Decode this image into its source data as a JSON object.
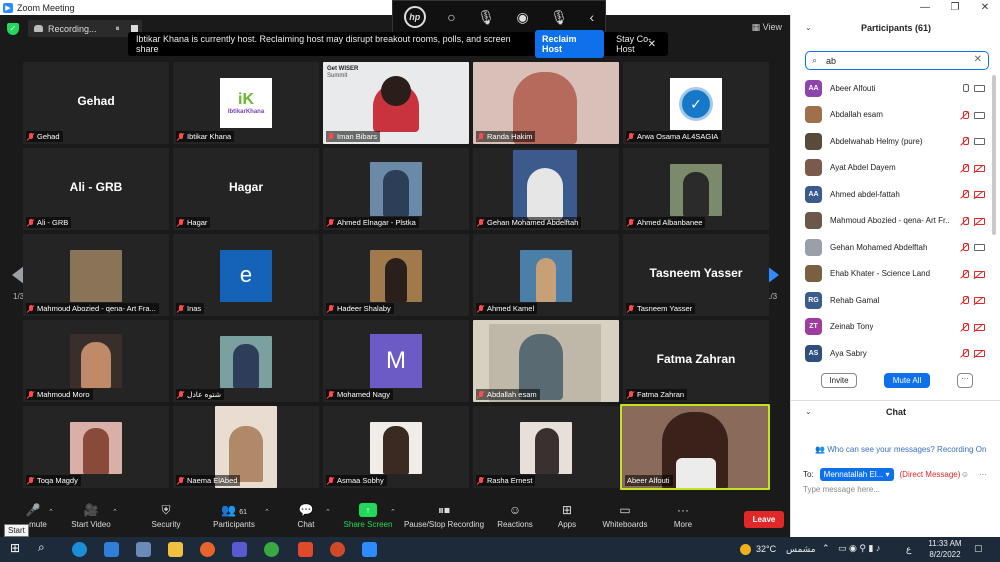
{
  "window": {
    "title": "Zoom Meeting",
    "minimize": "—",
    "restore": "❐",
    "close": "✕"
  },
  "topbar": {
    "recording": "Recording...",
    "pause": "⏸",
    "view": "View"
  },
  "hostbar": {
    "message": "Ibtikar Khana is currently host. Reclaiming host may disrupt breakout rooms, polls, and screen share",
    "reclaim": "Reclaim Host",
    "stay": "Stay Co-Host",
    "close": "✕"
  },
  "pager": {
    "left": "1/3",
    "right": "1/3"
  },
  "tiles": [
    {
      "label": "Gehad",
      "bigname": "Gehad"
    },
    {
      "label": "Ibtikar Khana",
      "logo_text": "iK",
      "logo_sub": "IbtikarKhana"
    },
    {
      "label": "Iman Bibars",
      "banner_title": "Get WISER",
      "banner_sub": "Summit"
    },
    {
      "label": "Randa Hakim"
    },
    {
      "label": "Arwa Osama AL4SAGIA"
    },
    {
      "label": "Ali - GRB",
      "bigname": "Ali - GRB"
    },
    {
      "label": "Hagar",
      "bigname": "Hagar"
    },
    {
      "label": "Ahmed Elnagar - Plstka"
    },
    {
      "label": "Gehan Mohamed Abdelftah"
    },
    {
      "label": "Ahmed Albanbanee"
    },
    {
      "label": "Mahmoud Abozied - qena- Art Fra..."
    },
    {
      "label": "Inas",
      "letter": "e"
    },
    {
      "label": "Hadeer Shalaby"
    },
    {
      "label": "Ahmed Kamel"
    },
    {
      "label": "Tasneem Yasser",
      "bigname": "Tasneem Yasser"
    },
    {
      "label": "Mahmoud Moro"
    },
    {
      "label": "شتوه عادل"
    },
    {
      "label": "Mohamed Nagy",
      "letter": "M"
    },
    {
      "label": "Abdallah esam"
    },
    {
      "label": "Fatma Zahran",
      "bigname": "Fatma Zahran"
    },
    {
      "label": "Toqa Magdy"
    },
    {
      "label": "Naema ElAbed"
    },
    {
      "label": "Asmaa Sobhy"
    },
    {
      "label": "Rasha Ernest"
    },
    {
      "label": "Abeer Alfouti"
    }
  ],
  "toolbar": {
    "mute": "mute",
    "start_tip": "Start",
    "start_video": "Start Video",
    "security": "Security",
    "participants": "Participants",
    "participants_count": "61",
    "chat": "Chat",
    "share": "Share Screen",
    "pause_rec": "Pause/Stop Recording",
    "reactions": "Reactions",
    "apps": "Apps",
    "whiteboards": "Whiteboards",
    "more": "More",
    "leave": "Leave"
  },
  "participants": {
    "header": "Participants (61)",
    "search_value": "ab",
    "list": [
      {
        "name": "Abeer Alfouti",
        "initials": "AA",
        "color": "#8e44ad",
        "mic": "on",
        "cam": "on"
      },
      {
        "name": "Abdallah esam",
        "initials": "",
        "color": "#a0704c",
        "mic": "off",
        "cam": "on"
      },
      {
        "name": "Abdelwahab Helmy (pure)",
        "initials": "",
        "color": "#5a4a3a",
        "mic": "off",
        "cam": "on"
      },
      {
        "name": "Ayat Abdel Dayem",
        "initials": "",
        "color": "#7a5a4a",
        "mic": "off",
        "cam": "off"
      },
      {
        "name": "Ahmed abdel-fattah",
        "initials": "AA",
        "color": "#3b5b8c",
        "mic": "off",
        "cam": "off"
      },
      {
        "name": "Mahmoud Abozied - qena- Art Fr...",
        "initials": "",
        "color": "#6b5848",
        "mic": "off",
        "cam": "off"
      },
      {
        "name": "Gehan Mohamed Abdelftah",
        "initials": "",
        "color": "#9aa0a8",
        "mic": "off",
        "cam": "on"
      },
      {
        "name": "Ehab Khater - Science Land",
        "initials": "",
        "color": "#7a6040",
        "mic": "off",
        "cam": "off"
      },
      {
        "name": "Rehab Gamal",
        "initials": "RG",
        "color": "#3b5b8c",
        "mic": "off",
        "cam": "off"
      },
      {
        "name": "Zeinab Tony",
        "initials": "ZT",
        "color": "#a03ca0",
        "mic": "off",
        "cam": "off"
      },
      {
        "name": "Aya Sabry",
        "initials": "AS",
        "color": "#2f4f7f",
        "mic": "off",
        "cam": "off"
      }
    ],
    "invite": "Invite",
    "mute_all": "Mute All",
    "more": "···"
  },
  "chat": {
    "header": "Chat",
    "info": "Who can see your messages? Recording On",
    "to_label": "To:",
    "to_value": "Mennatallah El... ▾",
    "dm": "(Direct Message)",
    "placeholder": "Type message here..."
  },
  "taskbar": {
    "weather": "32°C",
    "weather_text": "مشمس",
    "lang": "ع",
    "time": "11:33 AM",
    "date": "8/2/2022"
  },
  "colors": {
    "accent": "#0e71eb",
    "active_speaker": "#c2e41d",
    "leave": "#e02828",
    "share": "#23d959"
  }
}
